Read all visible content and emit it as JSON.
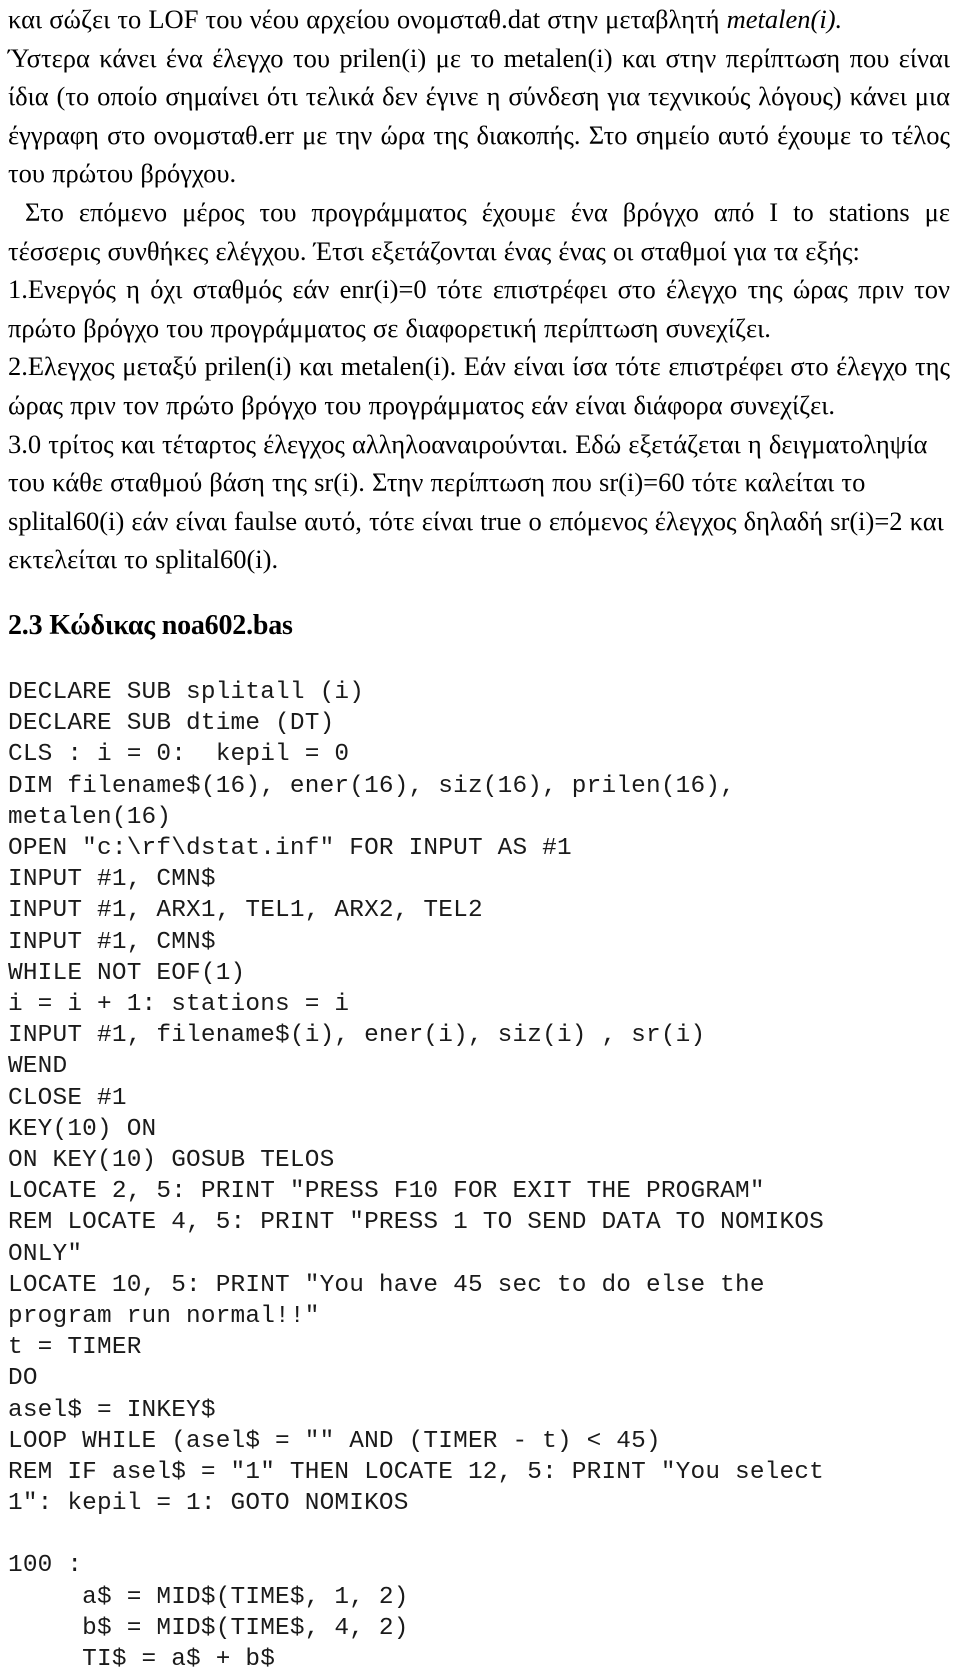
{
  "document": {
    "paragraphs": [
      {
        "id": "p1",
        "runs": [
          {
            "text": "και σώζει το LOF  του νέου αρχείου ονομσταθ.dat στην μεταβλητή  ",
            "style": "normal"
          },
          {
            "text": "metalen(i).",
            "style": "italic"
          }
        ],
        "text": "και σώζει το LOF  του νέου αρχείου ονομσταθ.dat στην μεταβλητή  metalen(i)."
      },
      {
        "id": "p2",
        "text": "Ύστερα κάνει ένα έλεγχο του prilen(i) με το metalen(i) και στην περίπτωση που είναι ίδια (το οποίο σημαίνει ότι τελικά δεν έγινε η σύνδεση για τεχνικούς  λόγους) κάνει μια έγγραφη στο ονομσταθ.err με την ώρα της διακοπής. Στο σημείο αυτό έχουμε το τέλος του πρώτου βρόγχου."
      },
      {
        "id": "p3",
        "text": "Στο επόμενο μέρος του προγράμματος έχουμε ένα βρόγχο από I to stations με τέσσερις  συνθήκες ελέγχου. Έτσι εξετάζονται ένας ένας οι σταθμοί για τα εξής:"
      },
      {
        "id": "p4",
        "text": "1.Ενεργός η όχι σταθμός εάν enr(i)=0 τότε επιστρέφει στο έλεγχο της ώρας πριν τον πρώτο βρόγχο του προγράμματος σε διαφορετική περίπτωση συνεχίζει."
      },
      {
        "id": "p5",
        "text": "2.Ελεγχος μεταξύ prilen(i) και metalen(i). Εάν είναι ίσα τότε επιστρέφει στο έλεγχο της ώρας πριν τον πρώτο βρόγχο του προγράμματος εάν είναι διάφορα συνεχίζει."
      },
      {
        "id": "p6",
        "text": "3.0 τρίτος και τέταρτος έλεγχος αλληλοαναιρούνται. Εδώ εξετάζεται η δειγματοληψία του κάθε σταθμού βάση της sr(i). Στην περίπτωση που sr(i)=60 τότε καλείται το splital60(i) εάν είναι faulse αυτό, τότε είναι true ο επόμενος έλεγχος δηλαδή sr(i)=2 και εκτελείται  το splital60(i)."
      }
    ],
    "section_heading": "2.3 Κώδικας noa602.bas",
    "code_listing": "DECLARE SUB splitall (i)\nDECLARE SUB dtime (DT)\nCLS : i = 0:  kepil = 0\nDIM filename$(16), ener(16), siz(16), prilen(16),\nmetalen(16)\nOPEN \"c:\\rf\\dstat.inf\" FOR INPUT AS #1\nINPUT #1, CMN$\nINPUT #1, ARX1, TEL1, ARX2, TEL2\nINPUT #1, CMN$\nWHILE NOT EOF(1)\ni = i + 1: stations = i\nINPUT #1, filename$(i), ener(i), siz(i) , sr(i)\nWEND\nCLOSE #1\nKEY(10) ON\nON KEY(10) GOSUB TELOS\nLOCATE 2, 5: PRINT \"PRESS F10 FOR EXIT THE PROGRAM\"\nREM LOCATE 4, 5: PRINT \"PRESS 1 TO SEND DATA TO NOMIKOS\nONLY\"\nLOCATE 10, 5: PRINT \"You have 45 sec to do else the\nprogram run normal!!\"\nt = TIMER\nDO\nasel$ = INKEY$\nLOOP WHILE (asel$ = \"\" AND (TIMER - t) < 45)\nREM IF asel$ = \"1\" THEN LOCATE 12, 5: PRINT \"You select\n1\": kepil = 1: GOTO NOMIKOS",
    "code_listing_continued": "100 :\n     a$ = MID$(TIME$, 1, 2)\n     b$ = MID$(TIME$, 4, 2)\n     TI$ = a$ + b$"
  }
}
